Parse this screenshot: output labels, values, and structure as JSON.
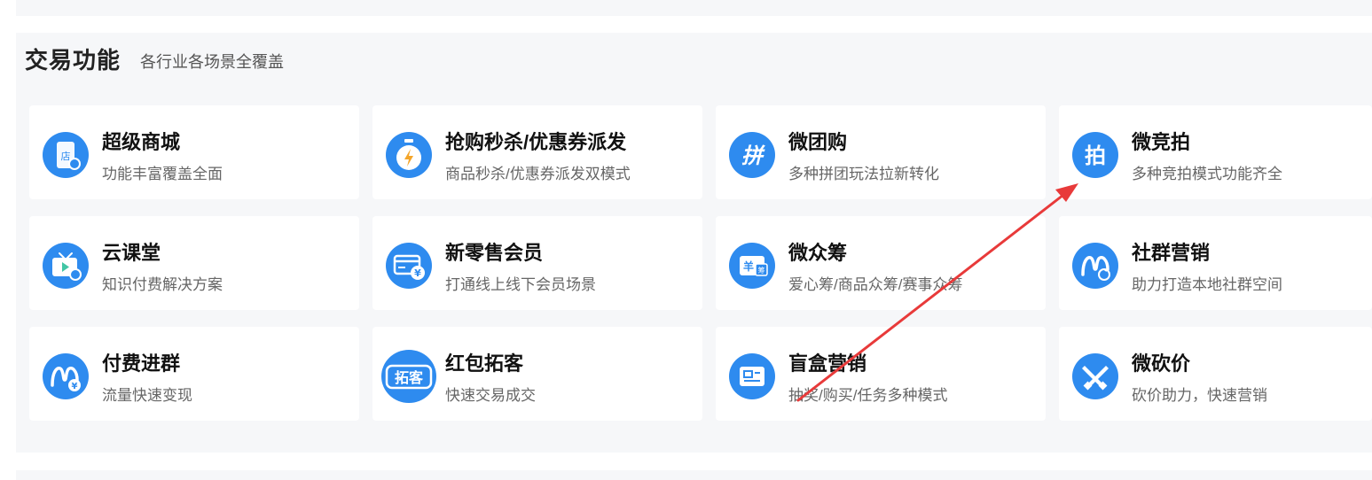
{
  "section": {
    "title": "交易功能",
    "subtitle": "各行业各场景全覆盖"
  },
  "cards": [
    {
      "title": "超级商城",
      "desc": "功能丰富覆盖全面",
      "icon": "store-phone-icon"
    },
    {
      "title": "抢购秒杀/优惠券派发",
      "desc": "商品秒杀/优惠券派发双模式",
      "icon": "stopwatch-lightning-icon"
    },
    {
      "title": "微团购",
      "desc": "多种拼团玩法拉新转化",
      "icon": "pin-group-buy-icon"
    },
    {
      "title": "微竞拍",
      "desc": "多种竞拍模式功能齐全",
      "icon": "auction-pai-icon"
    },
    {
      "title": "云课堂",
      "desc": "知识付费解决方案",
      "icon": "tv-course-icon"
    },
    {
      "title": "新零售会员",
      "desc": "打通线上线下会员场景",
      "icon": "member-card-yuan-icon"
    },
    {
      "title": "微众筹",
      "desc": "爱心筹/商品众筹/赛事众筹",
      "icon": "crowdfunding-card-icon"
    },
    {
      "title": "社群营销",
      "desc": "助力打造本地社群空间",
      "icon": "community-m-refresh-icon"
    },
    {
      "title": "付费进群",
      "desc": "流量快速变现",
      "icon": "paid-group-m-yuan-icon"
    },
    {
      "title": "红包拓客",
      "desc": "快速交易成交",
      "icon": "tuoke-badge-icon"
    },
    {
      "title": "盲盒营销",
      "desc": "抽奖/购买/任务多种模式",
      "icon": "blind-box-card-icon"
    },
    {
      "title": "微砍价",
      "desc": "砍价助力，快速营销",
      "icon": "crossed-knives-icon"
    }
  ],
  "icon_text": {
    "store": "店",
    "pin": "拼",
    "pai": "拍",
    "yuan": "¥",
    "yang": "羊",
    "chou": "筹",
    "tuoke": "拓客"
  },
  "colors": {
    "accent": "#2e8bef",
    "section_bg": "#f6f7f9",
    "annotation_arrow": "#e83a3a"
  }
}
